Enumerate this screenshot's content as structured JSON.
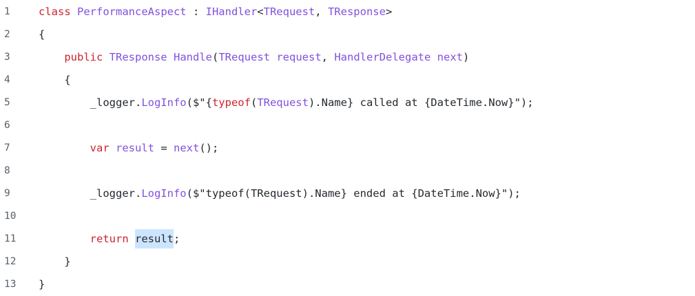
{
  "editor": {
    "lines": [
      {
        "number": "1",
        "indent": "",
        "tokens": [
          {
            "t": "class ",
            "c": "tok-kw"
          },
          {
            "t": "PerformanceAspect",
            "c": "tok-type"
          },
          {
            "t": " : ",
            "c": "tok-plain"
          },
          {
            "t": "IHandler",
            "c": "tok-type"
          },
          {
            "t": "<",
            "c": "tok-plain"
          },
          {
            "t": "TRequest",
            "c": "tok-type"
          },
          {
            "t": ", ",
            "c": "tok-plain"
          },
          {
            "t": "TResponse",
            "c": "tok-type"
          },
          {
            "t": ">",
            "c": "tok-plain"
          }
        ]
      },
      {
        "number": "2",
        "indent": "",
        "tokens": [
          {
            "t": "{",
            "c": "tok-brace"
          }
        ]
      },
      {
        "number": "3",
        "indent": "    ",
        "tokens": [
          {
            "t": "public ",
            "c": "tok-kw"
          },
          {
            "t": "TResponse",
            "c": "tok-type"
          },
          {
            "t": " ",
            "c": "tok-plain"
          },
          {
            "t": "Handle",
            "c": "tok-fn"
          },
          {
            "t": "(",
            "c": "tok-plain"
          },
          {
            "t": "TRequest",
            "c": "tok-type"
          },
          {
            "t": " ",
            "c": "tok-plain"
          },
          {
            "t": "request",
            "c": "tok-var"
          },
          {
            "t": ", ",
            "c": "tok-plain"
          },
          {
            "t": "HandlerDelegate",
            "c": "tok-type"
          },
          {
            "t": " ",
            "c": "tok-plain"
          },
          {
            "t": "next",
            "c": "tok-var"
          },
          {
            "t": ")",
            "c": "tok-plain"
          }
        ]
      },
      {
        "number": "4",
        "indent": "    ",
        "tokens": [
          {
            "t": "{",
            "c": "tok-brace"
          }
        ]
      },
      {
        "number": "5",
        "indent": "        ",
        "tokens": [
          {
            "t": "_logger.",
            "c": "tok-plain"
          },
          {
            "t": "LogInfo",
            "c": "tok-fn"
          },
          {
            "t": "($\"{",
            "c": "tok-plain"
          },
          {
            "t": "typeof",
            "c": "tok-kw"
          },
          {
            "t": "(",
            "c": "tok-plain"
          },
          {
            "t": "TRequest",
            "c": "tok-type"
          },
          {
            "t": ").Name} called at {DateTime.Now}\");",
            "c": "tok-plain"
          }
        ]
      },
      {
        "number": "6",
        "indent": "",
        "tokens": []
      },
      {
        "number": "7",
        "indent": "        ",
        "tokens": [
          {
            "t": "var ",
            "c": "tok-kw"
          },
          {
            "t": "result",
            "c": "tok-var"
          },
          {
            "t": " = ",
            "c": "tok-plain"
          },
          {
            "t": "next",
            "c": "tok-fn"
          },
          {
            "t": "();",
            "c": "tok-plain"
          }
        ]
      },
      {
        "number": "8",
        "indent": "",
        "tokens": []
      },
      {
        "number": "9",
        "indent": "        ",
        "tokens": [
          {
            "t": "_logger.",
            "c": "tok-plain"
          },
          {
            "t": "LogInfo",
            "c": "tok-fn"
          },
          {
            "t": "($\"typeof(TRequest).Name} ended at {DateTime.Now}\");",
            "c": "tok-plain"
          }
        ]
      },
      {
        "number": "10",
        "indent": "",
        "tokens": []
      },
      {
        "number": "11",
        "indent": "        ",
        "tokens": [
          {
            "t": "return ",
            "c": "tok-kw"
          },
          {
            "t": "result",
            "c": "tok-plain",
            "highlight": true
          },
          {
            "t": ";",
            "c": "tok-plain"
          }
        ]
      },
      {
        "number": "12",
        "indent": "    ",
        "tokens": [
          {
            "t": "}",
            "c": "tok-brace"
          }
        ]
      },
      {
        "number": "13",
        "indent": "",
        "tokens": [
          {
            "t": "}",
            "c": "tok-brace"
          }
        ]
      }
    ]
  }
}
